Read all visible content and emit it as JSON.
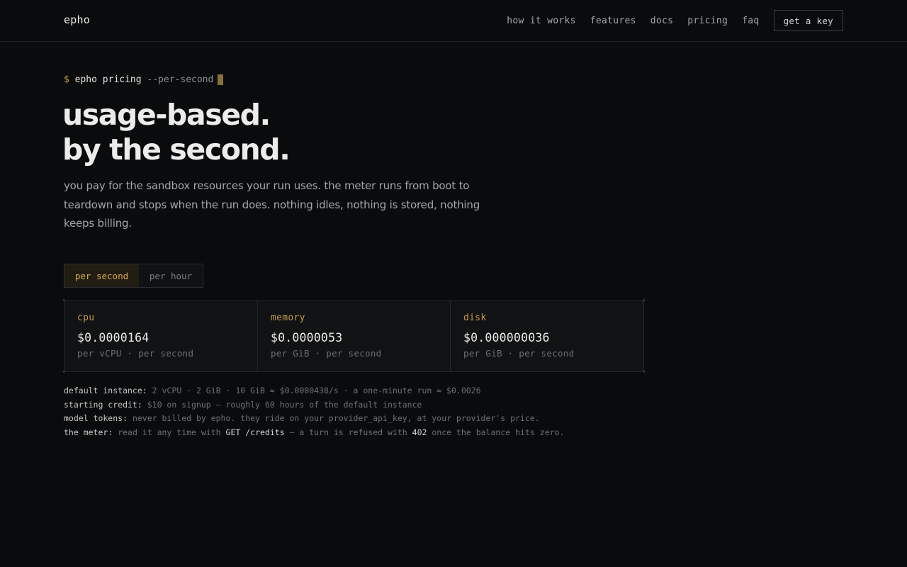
{
  "header": {
    "brand": "epho",
    "nav": [
      "how it works",
      "features",
      "docs",
      "pricing",
      "faq"
    ],
    "cta": "get a key"
  },
  "hero": {
    "prompt": {
      "symbol": "$",
      "command": "epho pricing",
      "flag": "--per-second"
    },
    "headline_line1": "usage-based.",
    "headline_line2": "by the second.",
    "lede": "you pay for the sandbox resources your run uses. the meter runs from boot to teardown and stops when the run does. nothing idles, nothing is stored, nothing keeps billing."
  },
  "toggle": {
    "options": [
      "per second",
      "per hour"
    ],
    "selected": "per second"
  },
  "prices": [
    {
      "label": "cpu",
      "price": "$0.0000164",
      "unit": "per vCPU · per second"
    },
    {
      "label": "memory",
      "price": "$0.0000053",
      "unit": "per GiB · per second"
    },
    {
      "label": "disk",
      "price": "$0.000000036",
      "unit": "per GiB · per second"
    }
  ],
  "notes": {
    "default_instance": {
      "key": "default instance:",
      "text": "2 vCPU · 2 GiB · 10 GiB ≈ $0.0000438/s · a one-minute run ≈ $0.0026"
    },
    "starting_credit": {
      "key": "starting credit:",
      "text": "$10 on signup — roughly 60 hours of the default instance"
    },
    "model_tokens": {
      "key": "model tokens:",
      "text": "never billed by epho. they ride on your provider_api_key, at your provider's price."
    },
    "meter": {
      "key": "the meter:",
      "text_before": "read it any time with",
      "endpoint": "GET /credits",
      "text_middle": "— a turn is refused with",
      "code": "402",
      "text_after": "once the balance hits zero."
    }
  },
  "colors": {
    "background": "#0a0b0d",
    "accent": "#d3a548",
    "text": "#ececea",
    "muted": "#6e7174"
  }
}
